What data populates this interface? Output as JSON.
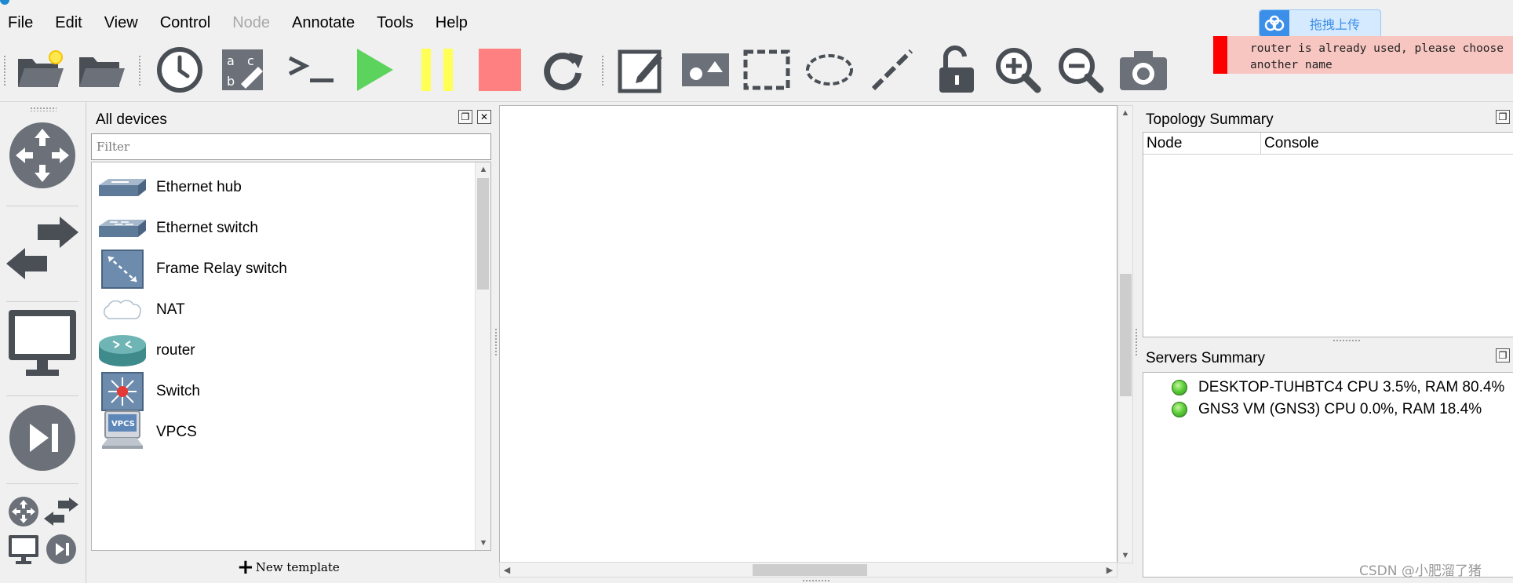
{
  "menu": [
    {
      "label": "File",
      "enabled": true
    },
    {
      "label": "Edit",
      "enabled": true
    },
    {
      "label": "View",
      "enabled": true
    },
    {
      "label": "Control",
      "enabled": true
    },
    {
      "label": "Node",
      "enabled": false
    },
    {
      "label": "Annotate",
      "enabled": true
    },
    {
      "label": "Tools",
      "enabled": true
    },
    {
      "label": "Help",
      "enabled": true
    }
  ],
  "toolbar": {
    "buttons": [
      "new-project-icon",
      "open-project-icon",
      "snapshot-clock-icon",
      "show-interface-labels-icon",
      "console-all-icon",
      "start-all-icon",
      "suspend-all-icon",
      "stop-all-icon",
      "reload-all-icon",
      "add-note-icon",
      "insert-picture-icon",
      "draw-rectangle-icon",
      "draw-ellipse-icon",
      "draw-line-icon",
      "lock-items-icon",
      "zoom-in-icon",
      "zoom-out-icon",
      "screenshot-icon"
    ],
    "colors": {
      "play": "#5cd35c",
      "pause": "#ffff55",
      "stop": "#ff8080"
    }
  },
  "upload_badge": {
    "label": "拖拽上传",
    "color": "#3b8fe8"
  },
  "error_notice": {
    "message": "router is already used, please choose\nanother name",
    "accent": "#ff0000",
    "background": "#f7c6c1"
  },
  "device_types": [
    "routers-icon",
    "switches-icon",
    "end-devices-icon",
    "security-devices-icon",
    "all-devices-icon"
  ],
  "devices_panel": {
    "title": "All devices",
    "filter_placeholder": "Filter",
    "items": [
      {
        "label": "Ethernet hub",
        "icon": "ethernet-hub-icon"
      },
      {
        "label": "Ethernet switch",
        "icon": "ethernet-switch-icon"
      },
      {
        "label": "Frame Relay switch",
        "icon": "frame-relay-switch-icon"
      },
      {
        "label": "NAT",
        "icon": "nat-cloud-icon"
      },
      {
        "label": "router",
        "icon": "router-icon"
      },
      {
        "label": "Switch",
        "icon": "multilayer-switch-icon"
      },
      {
        "label": "VPCS",
        "icon": "vpcs-icon"
      }
    ],
    "new_template": "New template"
  },
  "topology_summary": {
    "title": "Topology Summary",
    "columns": [
      "Node",
      "Console"
    ],
    "rows": []
  },
  "servers_summary": {
    "title": "Servers Summary",
    "servers": [
      {
        "label": "DESKTOP-TUHBTC4 CPU 3.5%, RAM 80.4%",
        "status": "running"
      },
      {
        "label": "GNS3 VM (GNS3) CPU 0.0%, RAM 18.4%",
        "status": "running"
      }
    ]
  },
  "watermark": "CSDN @小肥溜了猪"
}
